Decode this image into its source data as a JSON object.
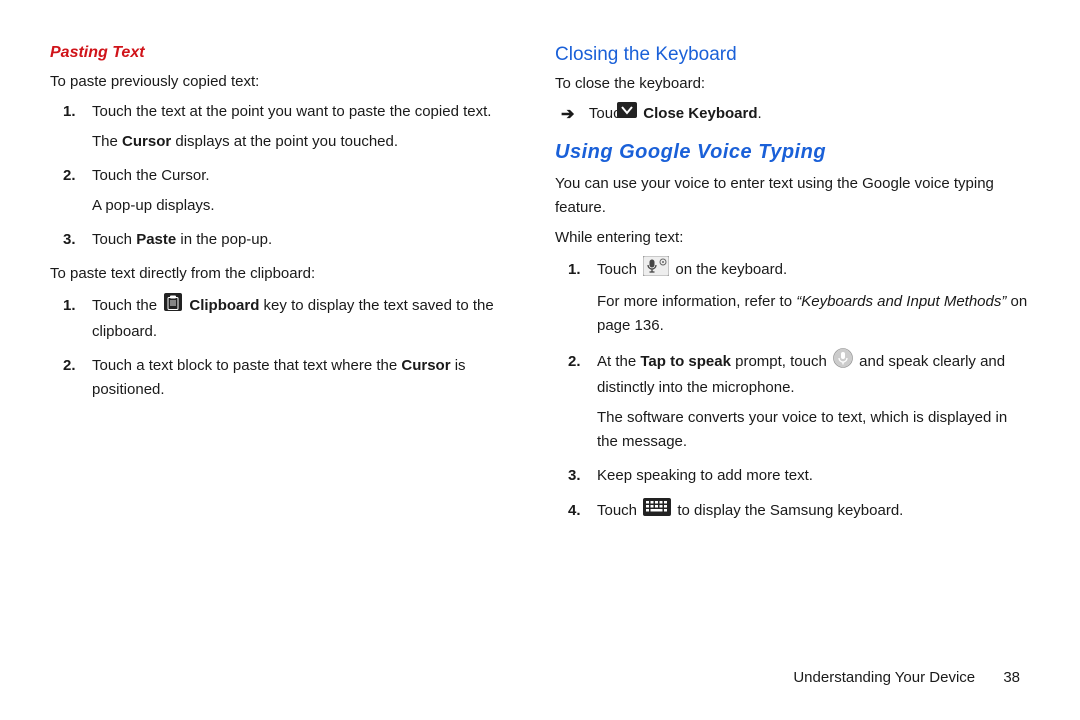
{
  "left": {
    "h_pasting": "Pasting Text",
    "p_intro1": "To paste previously copied text:",
    "step1_a": "Touch the text at the point you want to paste the copied text.",
    "step1_b_pre": "The ",
    "step1_b_bold": "Cursor",
    "step1_b_post": " displays at the point you touched.",
    "step2_a": "Touch the Cursor.",
    "step2_b": "A pop-up displays.",
    "step3_pre": "Touch ",
    "step3_bold": "Paste",
    "step3_post": " in the pop-up.",
    "p_intro2": "To paste text directly from the clipboard:",
    "cb_step1_pre": "Touch the ",
    "cb_step1_bold": "Clipboard",
    "cb_step1_post": " key to display the text saved to the clipboard.",
    "cb_step2_pre": "Touch a text block to paste that text where the ",
    "cb_step2_bold": "Cursor",
    "cb_step2_post": " is positioned."
  },
  "right": {
    "h_closing": "Closing the Keyboard",
    "p_close_intro": "To close the keyboard:",
    "close_touch": "Touch ",
    "close_label": "Close Keyboard",
    "h_voice": "Using Google Voice Typing",
    "voice_intro": "You can use your voice to enter text using the Google voice typing feature.",
    "voice_while": "While entering text:",
    "v1_pre": "Touch ",
    "v1_post": " on the keyboard.",
    "v1_ref_pre": "For more information, refer to ",
    "v1_ref_ital": "“Keyboards and Input Methods”",
    "v1_ref_post": " on page 136.",
    "v2_pre": "At the ",
    "v2_bold": "Tap to speak",
    "v2_mid": " prompt, touch ",
    "v2_post": " and speak clearly and distinctly into the microphone.",
    "v2_conv": "The software converts your voice to text, which is displayed in the message.",
    "v3": "Keep speaking to add more text.",
    "v4_pre": "Touch ",
    "v4_post": " to display the Samsung keyboard."
  },
  "footer": {
    "section": "Understanding Your Device",
    "page": "38"
  }
}
